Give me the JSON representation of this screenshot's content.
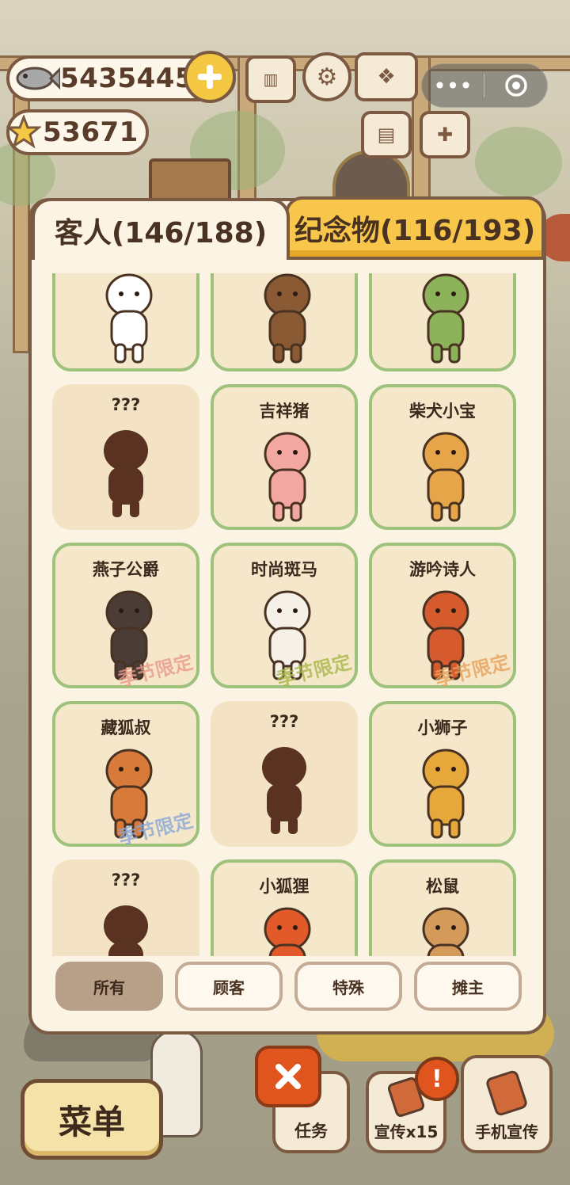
{
  "resources": {
    "fish": "54354459",
    "stars": "53671"
  },
  "tabs": {
    "guests": "客人(146/188)",
    "souvenirs": "纪念物(116/193)"
  },
  "cards": [
    {
      "name": "",
      "color": "#ffffff",
      "limited": ""
    },
    {
      "name": "",
      "color": "#8a5a34",
      "limited": ""
    },
    {
      "name": "",
      "color": "#8cb25a",
      "limited": ""
    },
    {
      "name": "???",
      "color": "#5a3222",
      "limited": ""
    },
    {
      "name": "吉祥猪",
      "color": "#f2a8a0",
      "limited": ""
    },
    {
      "name": "柴犬小宝",
      "color": "#e6a548",
      "limited": ""
    },
    {
      "name": "燕子公爵",
      "color": "#4a3c36",
      "limited": "季节限定"
    },
    {
      "name": "时尚斑马",
      "color": "#f6f1e8",
      "limited": "季节限定"
    },
    {
      "name": "游吟诗人",
      "color": "#d55a2e",
      "limited": "季节限定"
    },
    {
      "name": "藏狐叔",
      "color": "#d87a3a",
      "limited": "季节限定"
    },
    {
      "name": "???",
      "color": "#5a3222",
      "limited": ""
    },
    {
      "name": "小狮子",
      "color": "#e6a83a",
      "limited": ""
    },
    {
      "name": "???",
      "color": "#5a3222",
      "limited": ""
    },
    {
      "name": "小狐狸",
      "color": "#e25a2a",
      "limited": ""
    },
    {
      "name": "松鼠",
      "color": "#d49a5a",
      "limited": ""
    }
  ],
  "filters": {
    "all": "所有",
    "customers": "顾客",
    "special": "特殊",
    "vendors": "摊主"
  },
  "bottom": {
    "menu": "菜单",
    "tasks": "任务",
    "promo": "宣传x15",
    "phone_promo": "手机宣传"
  },
  "colors": {
    "limited_pink": "#e99a8a",
    "limited_green": "#a8b84a",
    "limited_orange": "#e8a25a",
    "limited_blue": "#8aa8d8",
    "tab_yellow": "#f7c64b",
    "card_border": "#9ec27c"
  }
}
